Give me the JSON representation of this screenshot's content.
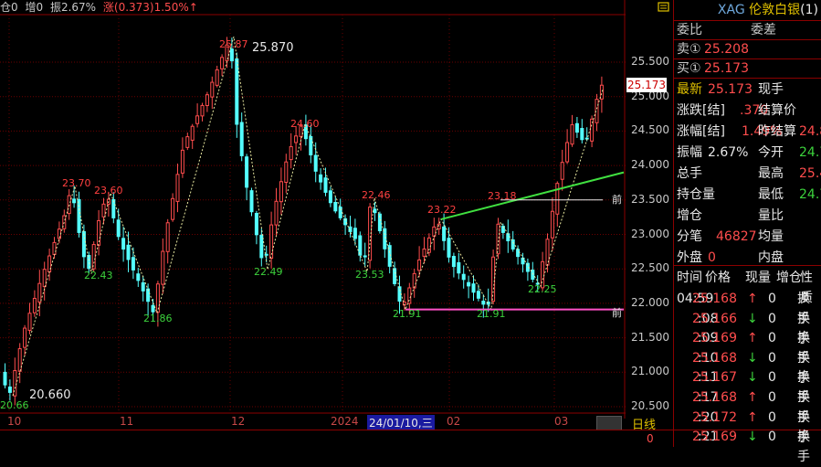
{
  "top": {
    "c0": "仓0",
    "c1": "增0",
    "c2": "振2.67%",
    "c3": "涨(0.373)1.50%↑"
  },
  "chart_data": {
    "type": "candlestick",
    "yticks": [
      "25.500",
      "25.000",
      "24.500",
      "24.000",
      "23.500",
      "23.000",
      "22.500",
      "22.000",
      "21.500",
      "21.000",
      "20.500"
    ],
    "ylim": [
      20.5,
      25.5
    ],
    "xticks": [
      "10",
      "11",
      "12",
      "2024",
      "24/01/10,三",
      "02",
      "03"
    ],
    "current_price": "25.173",
    "high_label": "25.870",
    "low_label": "20.660",
    "peak_labels": [
      "20.66",
      "23.70",
      "22.43",
      "23.60",
      "21.86",
      "25.87",
      "22.49",
      "24.60",
      "23.53",
      "22.46",
      "21.91",
      "23.22",
      "21.91",
      "23.18",
      "22.25"
    ],
    "support_line_labels": [
      "前",
      "前"
    ],
    "series": []
  },
  "xaxis": {
    "day_label": "日线",
    "bottom_val": "0"
  },
  "panel": {
    "title_sym": "XAG",
    "title_name": "伦敦白银",
    "title_num": "(1)",
    "weibi": "委比",
    "weicha": "委差",
    "sell_label": "卖①",
    "sell_val": "25.208",
    "buy_label": "买①",
    "buy_val": "25.173",
    "rows": [
      {
        "l1": "最新",
        "v1": "25.173",
        "l2": "现手",
        "v2": ""
      },
      {
        "l1": "涨跌[结]",
        "v1": ".370",
        "l2": "结算价",
        "v2": ""
      },
      {
        "l1": "涨幅[结]",
        "v1": "1.49%",
        "l2": "昨结算",
        "v2": "24.8"
      },
      {
        "l1": "振幅",
        "v1": "2.67%",
        "l2": "今开",
        "v2": "24.7"
      },
      {
        "l1": "总手",
        "v1": "",
        "l2": "最高",
        "v2": "25.4"
      },
      {
        "l1": "持仓量",
        "v1": "",
        "l2": "最低",
        "v2": "24.7"
      },
      {
        "l1": "增仓",
        "v1": "",
        "l2": "量比",
        "v2": ""
      },
      {
        "l1": "分笔",
        "v1": "46827",
        "l2": "均量",
        "v2": ""
      },
      {
        "l1": "外盘",
        "v1": "0",
        "l2": "内盘",
        "v2": ""
      }
    ],
    "tick_header": [
      "时间",
      "价格",
      "现量",
      "增仓",
      "性质"
    ],
    "ticks": [
      {
        "t": "04:59",
        "p": "25.168",
        "d": "↑",
        "q": "0",
        "k": "换手"
      },
      {
        "t": ":08",
        "p": "25.166",
        "d": "↓",
        "q": "0",
        "k": "换手"
      },
      {
        "t": ":09",
        "p": "25.169",
        "d": "↑",
        "q": "0",
        "k": "换手"
      },
      {
        "t": ":10",
        "p": "25.168",
        "d": "↓",
        "q": "0",
        "k": "换手"
      },
      {
        "t": ":11",
        "p": "25.167",
        "d": "↓",
        "q": "0",
        "k": "换手"
      },
      {
        "t": ":17",
        "p": "25.168",
        "d": "↑",
        "q": "0",
        "k": "换手"
      },
      {
        "t": ":20",
        "p": "25.172",
        "d": "↑",
        "q": "0",
        "k": "换手"
      },
      {
        "t": ":21",
        "p": "25.169",
        "d": "↓",
        "q": "0",
        "k": "换手"
      }
    ]
  }
}
